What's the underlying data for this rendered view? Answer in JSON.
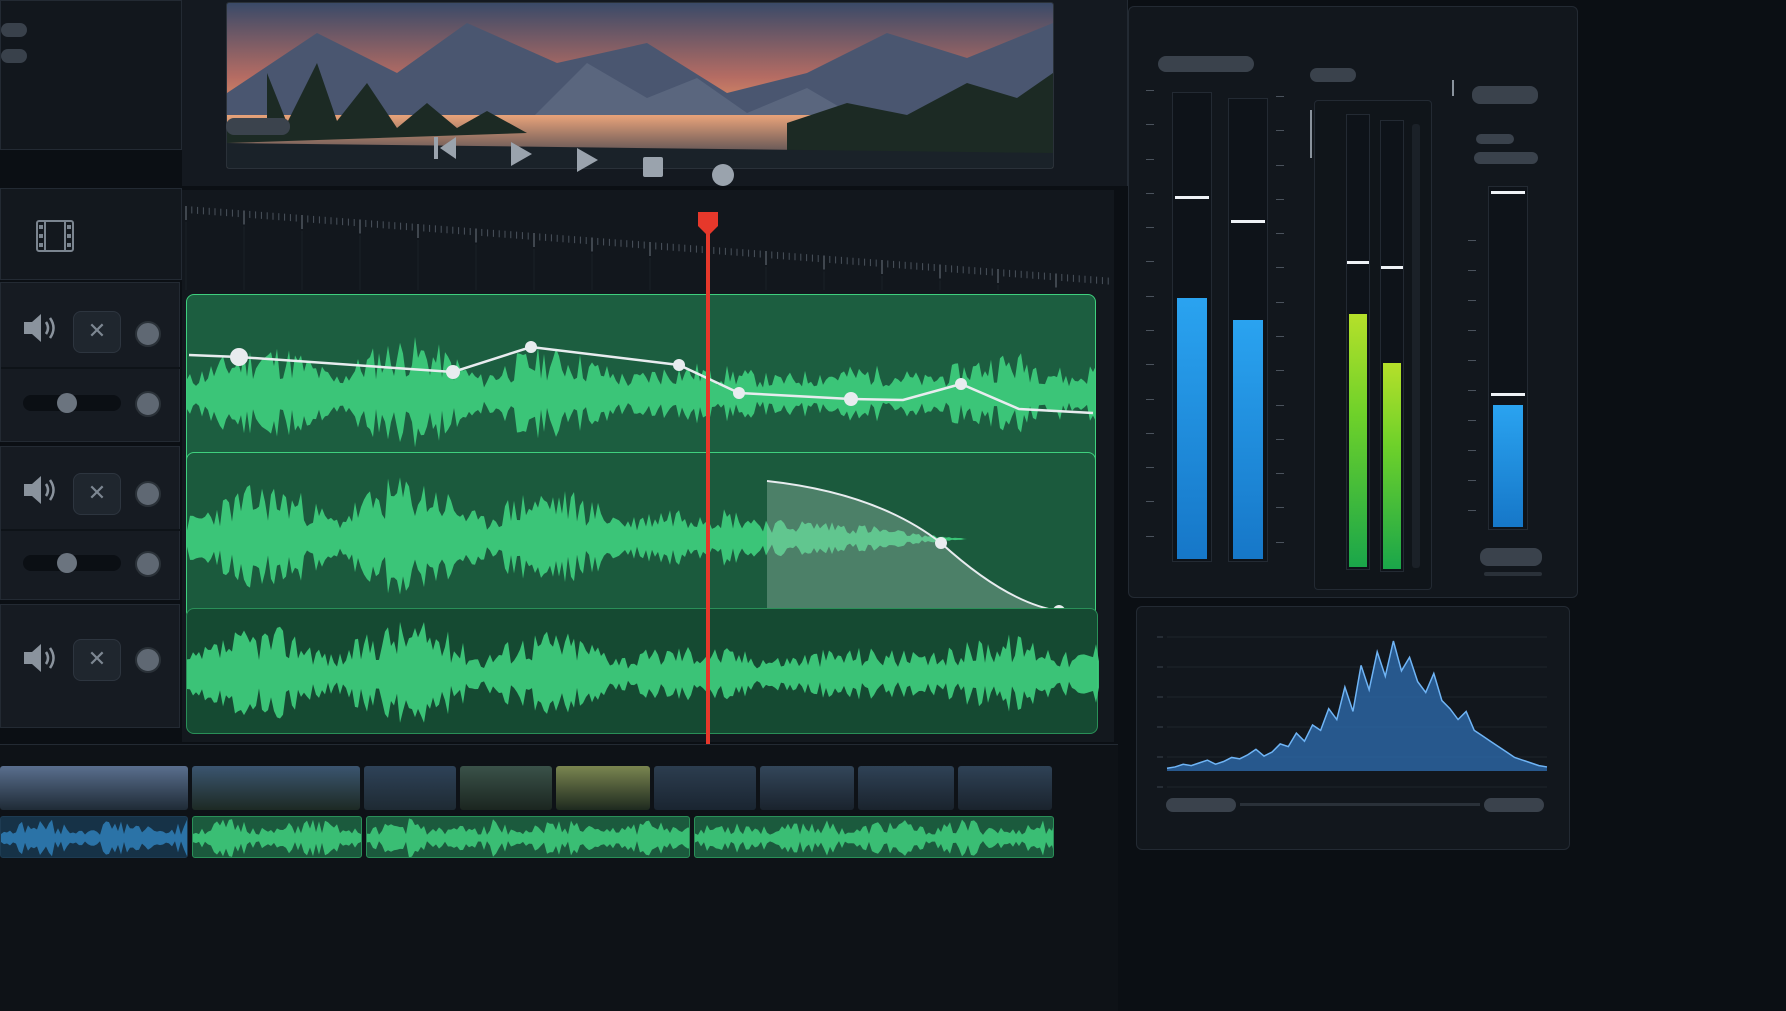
{
  "app": {
    "theme": "dark",
    "accent_colors": {
      "waveform_green": "#3fd07e",
      "clip_green": "#1e6b47",
      "playhead_red": "#e6382b",
      "meter_blue": "#1f8fe0",
      "meter_green": "#6ed12a",
      "spectrum_blue": "#2f6fb3"
    }
  },
  "transport": {
    "buttons": [
      {
        "name": "skip-back",
        "icon": "skip-back-icon"
      },
      {
        "name": "play",
        "icon": "play-icon"
      },
      {
        "name": "play-alt",
        "icon": "play-icon"
      },
      {
        "name": "stop",
        "icon": "stop-icon"
      },
      {
        "name": "record",
        "icon": "record-icon"
      }
    ]
  },
  "tracks": [
    {
      "name": "track-1",
      "icons": [
        "speaker-icon",
        "close-icon"
      ],
      "has_volume_slider": true,
      "volume": 0.45
    },
    {
      "name": "track-2",
      "icons": [
        "speaker-icon",
        "close-icon"
      ],
      "has_volume_slider": true,
      "volume": 0.4
    },
    {
      "name": "track-3",
      "icons": [
        "speaker-icon",
        "close-icon"
      ],
      "has_volume_slider": false
    }
  ],
  "mute_glyph": "✕",
  "timeline": {
    "header_icon": "film-strip-icon",
    "playhead_color": "#e6382b"
  },
  "meters": {
    "left_pair_levels": [
      0.56,
      0.52
    ],
    "left_pair_peaks": [
      0.78,
      0.74
    ],
    "right_pair_levels": [
      0.56,
      0.46
    ],
    "right_pair_peaks": [
      0.68,
      0.68
    ],
    "single_level": 0.36,
    "single_peak": 0.4
  },
  "spectrum": {
    "values": [
      2,
      3,
      5,
      4,
      6,
      8,
      5,
      7,
      10,
      9,
      12,
      16,
      11,
      14,
      20,
      18,
      28,
      22,
      34,
      30,
      46,
      38,
      62,
      44,
      78,
      60,
      88,
      70,
      96,
      74,
      84,
      66,
      58,
      72,
      52,
      46,
      38,
      44,
      30,
      26,
      22,
      18,
      14,
      10,
      8,
      6,
      4,
      3
    ]
  }
}
